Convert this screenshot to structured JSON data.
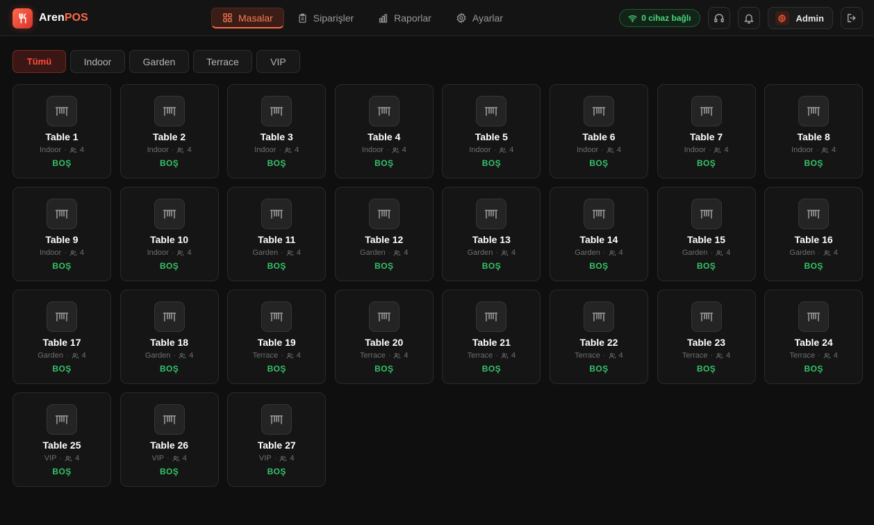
{
  "app": {
    "name_part1": "Aren",
    "name_part2": "POS"
  },
  "nav": [
    {
      "label": "Masalar",
      "icon": "grid-icon",
      "active": true
    },
    {
      "label": "Siparişler",
      "icon": "clipboard-icon",
      "active": false
    },
    {
      "label": "Raporlar",
      "icon": "bar-chart-icon",
      "active": false
    },
    {
      "label": "Ayarlar",
      "icon": "gear-icon",
      "active": false
    }
  ],
  "header_right": {
    "device_status": "0 cihaz bağlı",
    "user": "Admin"
  },
  "colors": {
    "accent": "#ff6a45",
    "free_status": "#35c46a",
    "active_filter": "#ff4d3d"
  },
  "filters": [
    {
      "label": "Tümü",
      "active": true
    },
    {
      "label": "Indoor",
      "active": false
    },
    {
      "label": "Garden",
      "active": false
    },
    {
      "label": "Terrace",
      "active": false
    },
    {
      "label": "VIP",
      "active": false
    }
  ],
  "tables": [
    {
      "name": "Table 1",
      "area": "Indoor",
      "seats": "4",
      "status": "BOŞ"
    },
    {
      "name": "Table 2",
      "area": "Indoor",
      "seats": "4",
      "status": "BOŞ"
    },
    {
      "name": "Table 3",
      "area": "Indoor",
      "seats": "4",
      "status": "BOŞ"
    },
    {
      "name": "Table 4",
      "area": "Indoor",
      "seats": "4",
      "status": "BOŞ"
    },
    {
      "name": "Table 5",
      "area": "Indoor",
      "seats": "4",
      "status": "BOŞ"
    },
    {
      "name": "Table 6",
      "area": "Indoor",
      "seats": "4",
      "status": "BOŞ"
    },
    {
      "name": "Table 7",
      "area": "Indoor",
      "seats": "4",
      "status": "BOŞ"
    },
    {
      "name": "Table 8",
      "area": "Indoor",
      "seats": "4",
      "status": "BOŞ"
    },
    {
      "name": "Table 9",
      "area": "Indoor",
      "seats": "4",
      "status": "BOŞ"
    },
    {
      "name": "Table 10",
      "area": "Indoor",
      "seats": "4",
      "status": "BOŞ"
    },
    {
      "name": "Table 11",
      "area": "Garden",
      "seats": "4",
      "status": "BOŞ"
    },
    {
      "name": "Table 12",
      "area": "Garden",
      "seats": "4",
      "status": "BOŞ"
    },
    {
      "name": "Table 13",
      "area": "Garden",
      "seats": "4",
      "status": "BOŞ"
    },
    {
      "name": "Table 14",
      "area": "Garden",
      "seats": "4",
      "status": "BOŞ"
    },
    {
      "name": "Table 15",
      "area": "Garden",
      "seats": "4",
      "status": "BOŞ"
    },
    {
      "name": "Table 16",
      "area": "Garden",
      "seats": "4",
      "status": "BOŞ"
    },
    {
      "name": "Table 17",
      "area": "Garden",
      "seats": "4",
      "status": "BOŞ"
    },
    {
      "name": "Table 18",
      "area": "Garden",
      "seats": "4",
      "status": "BOŞ"
    },
    {
      "name": "Table 19",
      "area": "Terrace",
      "seats": "4",
      "status": "BOŞ"
    },
    {
      "name": "Table 20",
      "area": "Terrace",
      "seats": "4",
      "status": "BOŞ"
    },
    {
      "name": "Table 21",
      "area": "Terrace",
      "seats": "4",
      "status": "BOŞ"
    },
    {
      "name": "Table 22",
      "area": "Terrace",
      "seats": "4",
      "status": "BOŞ"
    },
    {
      "name": "Table 23",
      "area": "Terrace",
      "seats": "4",
      "status": "BOŞ"
    },
    {
      "name": "Table 24",
      "area": "Terrace",
      "seats": "4",
      "status": "BOŞ"
    },
    {
      "name": "Table 25",
      "area": "VIP",
      "seats": "4",
      "status": "BOŞ"
    },
    {
      "name": "Table 26",
      "area": "VIP",
      "seats": "4",
      "status": "BOŞ"
    },
    {
      "name": "Table 27",
      "area": "VIP",
      "seats": "4",
      "status": "BOŞ"
    }
  ]
}
